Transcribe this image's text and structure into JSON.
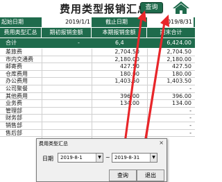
{
  "header": {
    "title": "费用类型报销汇总",
    "query_label": "查询"
  },
  "date_row": {
    "start_label": "起始日期",
    "start_value": "2019/1/1",
    "end_label": "截止日期",
    "end_value": "2019/8/31"
  },
  "columns": [
    "费用类型汇总",
    "期初报销金额",
    "本期报销金额",
    "期末合计"
  ],
  "total_row": {
    "label": "合计",
    "opening": "-",
    "current": "6,4",
    "closing": "6,424.00"
  },
  "rows": [
    {
      "name": "差旅费",
      "current": "2,704.50",
      "closing": "2,704.50"
    },
    {
      "name": "市内交通费",
      "current": "2,180.00",
      "closing": "2,180.00"
    },
    {
      "name": "邮寄费",
      "current": "427.50",
      "closing": "427.50"
    },
    {
      "name": "仓库费用",
      "current": "180.00",
      "closing": "180.00"
    },
    {
      "name": "办公费用",
      "current": "1,403.50",
      "closing": "1,403.50"
    },
    {
      "name": "公司聚餐",
      "current": "",
      "closing": "-"
    },
    {
      "name": "其他费用",
      "current": "396.00",
      "closing": "396.00"
    },
    {
      "name": "业务费",
      "current": "134.00",
      "closing": "134.00"
    },
    {
      "name": "管理部",
      "current": "",
      "closing": "-"
    },
    {
      "name": "财务部",
      "current": "",
      "closing": "-"
    },
    {
      "name": "销售部",
      "current": "",
      "closing": "-"
    },
    {
      "name": "售后部",
      "current": "",
      "closing": "-"
    }
  ],
  "dialog": {
    "title": "费用类型汇总",
    "close_glyph": "×",
    "date_label": "日期",
    "start_value": "2019-8-1",
    "separator": "~",
    "end_value": "2019-8-31",
    "query_button": "查询",
    "exit_button": "退出"
  },
  "colors": {
    "header_green": "#1f6b4c",
    "arrow_red": "#e8262a"
  }
}
